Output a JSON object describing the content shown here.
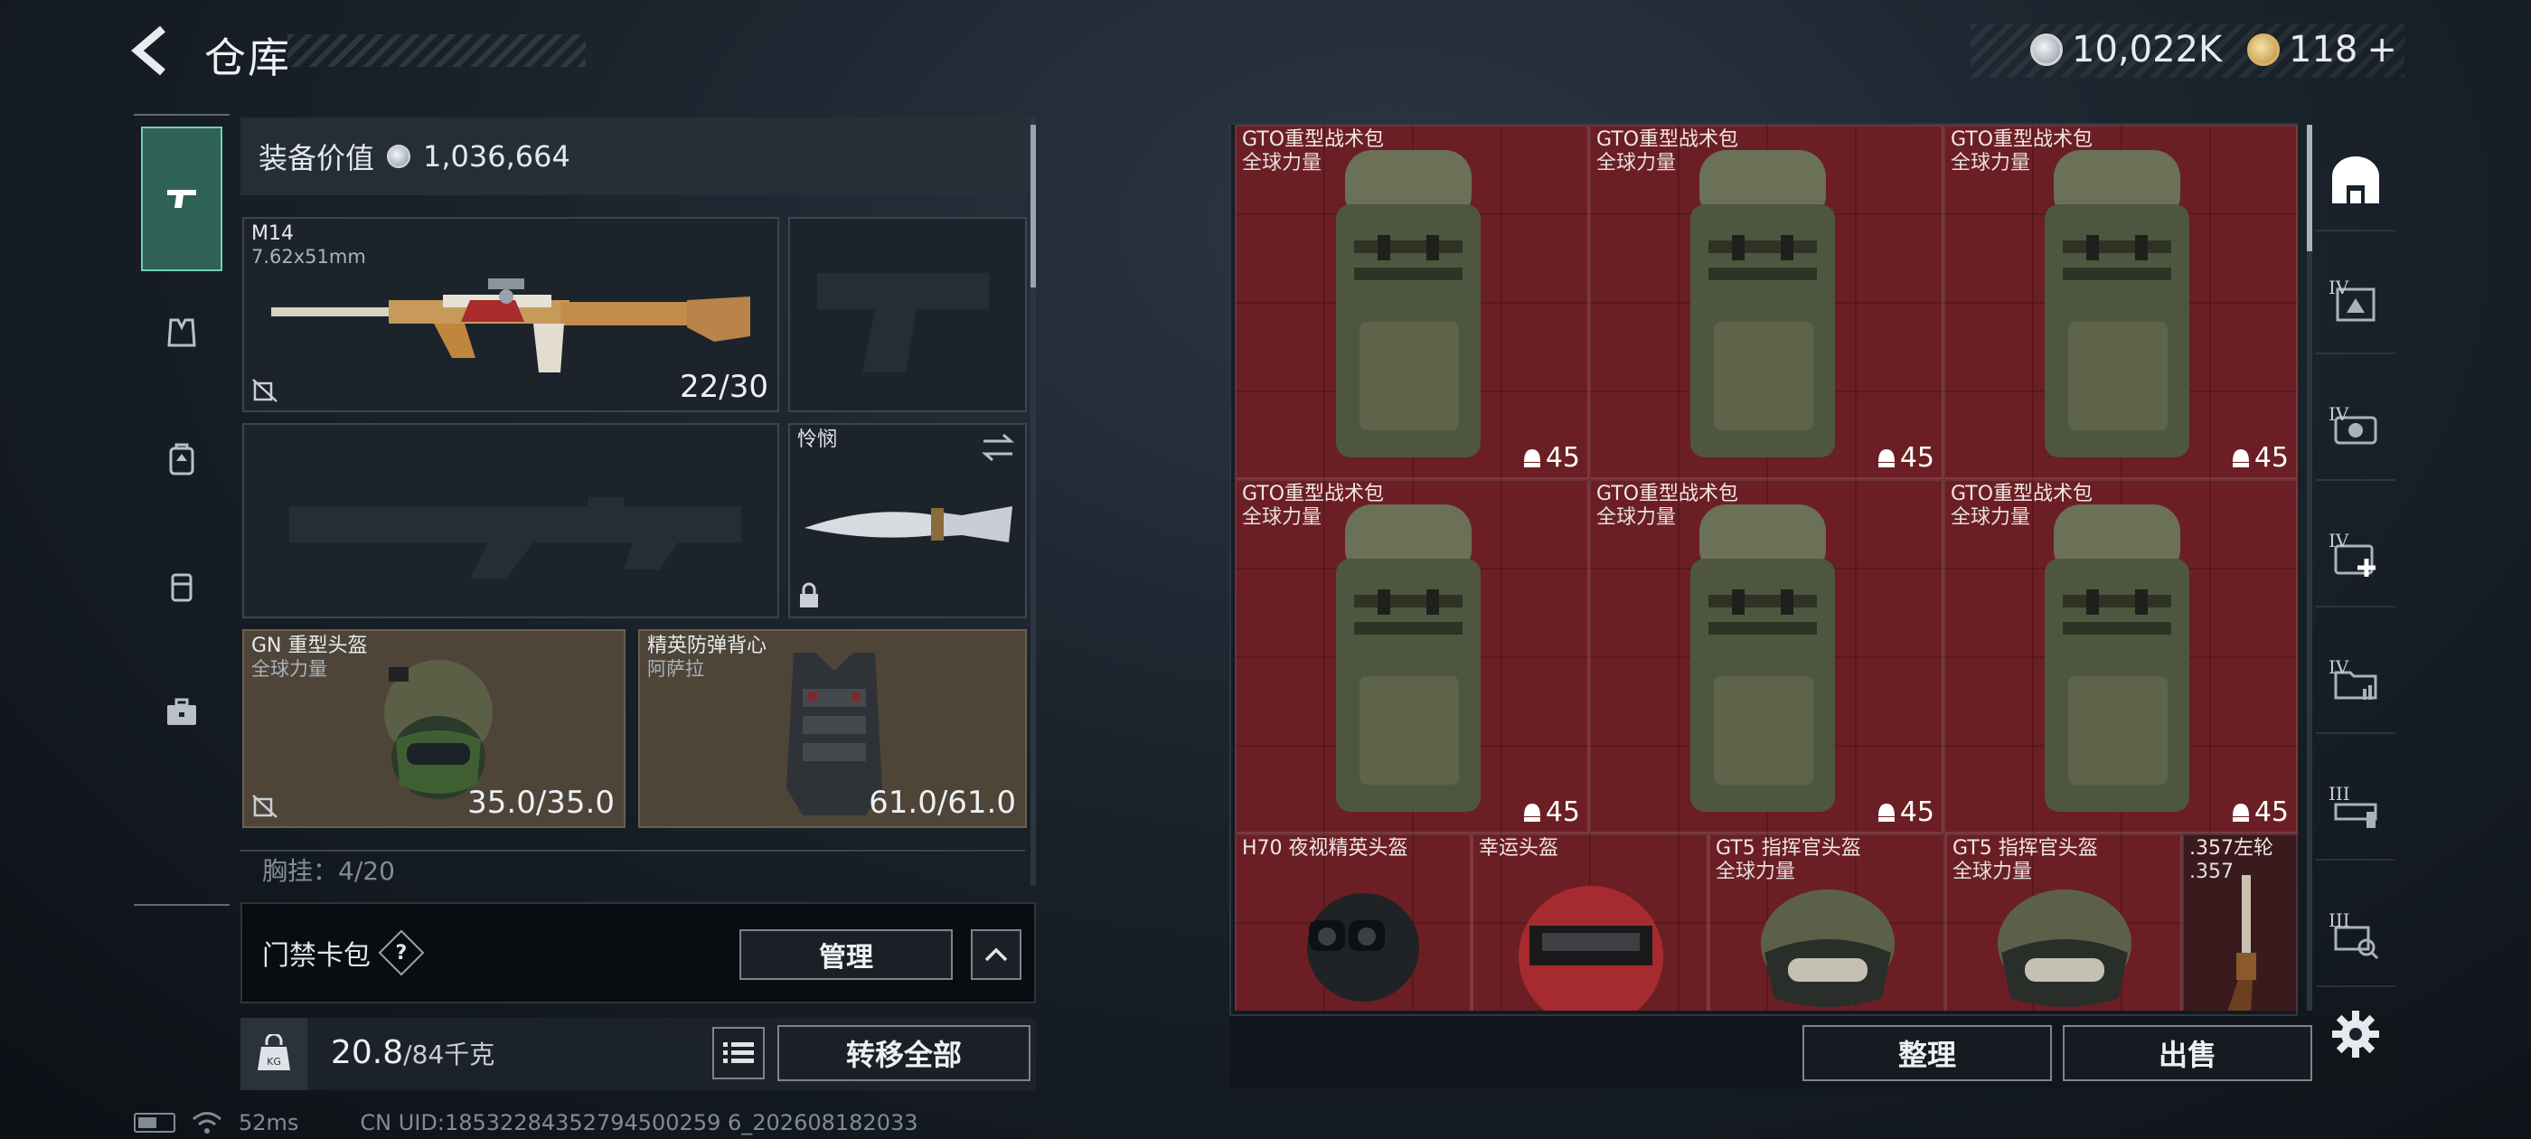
{
  "header": {
    "title": "仓库",
    "currency_silver": "10,022K",
    "currency_gold": "118",
    "currency_gold_plus": "+"
  },
  "loadout": {
    "value_label": "装备价值",
    "value": "1,036,664",
    "primary_weapon": {
      "name": "M14",
      "caliber": "7.62x51mm",
      "ammo": "22/30"
    },
    "melee": {
      "name": "怜悯"
    },
    "helmet": {
      "name": "GN 重型头盔",
      "brand": "全球力量",
      "durability": "35.0/35.0"
    },
    "armor": {
      "name": "精英防弹背心",
      "brand": "阿萨拉",
      "durability": "61.0/61.0"
    },
    "chest_rig_partial": "胸挂：4/20"
  },
  "cardpack": {
    "label": "门禁卡包",
    "help": "?",
    "manage_label": "管理"
  },
  "bottom_bar": {
    "weight_current": "20.8",
    "weight_max": "/84千克",
    "transfer_all_label": "转移全部"
  },
  "status": {
    "ping": "52ms",
    "uid": "CN UID:18532284352794500259 6_202608182033"
  },
  "storage": {
    "items": [
      {
        "name": "GTO重型战术包",
        "brand": "全球力量",
        "count": "45"
      },
      {
        "name": "GTO重型战术包",
        "brand": "全球力量",
        "count": "45"
      },
      {
        "name": "GTO重型战术包",
        "brand": "全球力量",
        "count": "45"
      },
      {
        "name": "GTO重型战术包",
        "brand": "全球力量",
        "count": "45"
      },
      {
        "name": "GTO重型战术包",
        "brand": "全球力量",
        "count": "45"
      },
      {
        "name": "GTO重型战术包",
        "brand": "全球力量",
        "count": "45"
      }
    ],
    "helmets": [
      {
        "name": "H70 夜视精英头盔",
        "brand": ""
      },
      {
        "name": "幸运头盔",
        "brand": ""
      },
      {
        "name": "GT5 指挥官头盔",
        "brand": "全球力量"
      },
      {
        "name": "GT5 指挥官头盔",
        "brand": "全球力量"
      },
      {
        "name": ".357左轮",
        "brand": ".357"
      }
    ],
    "sort_label": "整理",
    "sell_label": "出售"
  },
  "filters": [
    {
      "icon": "shelter-icon",
      "tier": ""
    },
    {
      "icon": "tier-iv-crate-icon",
      "tier": "IV"
    },
    {
      "icon": "tier-iv-device-icon",
      "tier": "IV"
    },
    {
      "icon": "tier-iv-medkit-icon",
      "tier": "IV"
    },
    {
      "icon": "tier-iv-folder-icon",
      "tier": "IV"
    },
    {
      "icon": "tier-iii-tool-icon",
      "tier": "III"
    },
    {
      "icon": "tier-iii-search-icon",
      "tier": "III"
    }
  ],
  "colors": {
    "storage_bg": "#6b1f24",
    "active_tab": "#2f6154",
    "brown_slot": "#4e4538"
  }
}
